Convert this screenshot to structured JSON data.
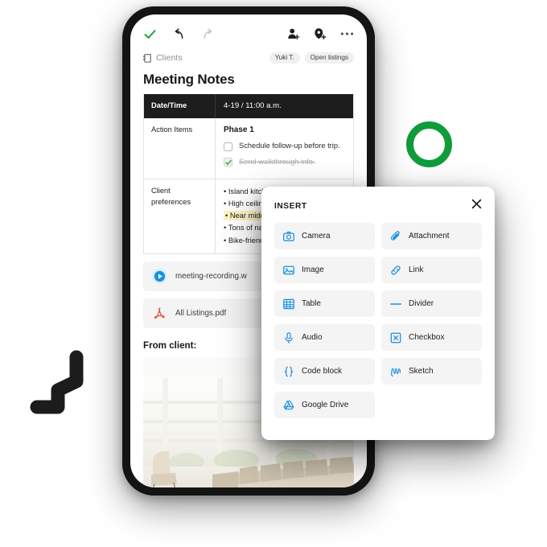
{
  "app": {
    "toolbar": {
      "confirm_label": "check-icon",
      "undo_label": "undo-icon",
      "redo_label": "redo-icon",
      "add_person_label": "add-person-icon",
      "add_tag_label": "add-tag-icon",
      "more_label": "more-options-icon"
    },
    "breadcrumb": {
      "icon": "notebook-icon",
      "label": "Clients"
    },
    "chips": [
      {
        "label": "Yuki T."
      },
      {
        "label": "Open listings"
      }
    ],
    "title": "Meeting Notes"
  },
  "table": {
    "header": {
      "key": "Date/Time",
      "value": "4-19 / 11:00 a.m."
    },
    "rows": [
      {
        "key": "Action Items",
        "phase": "Phase 1",
        "checklist": [
          {
            "label": "Schedule follow-up before trip.",
            "checked": false
          },
          {
            "label": "Send walkthrough info.",
            "checked": true
          }
        ]
      },
      {
        "key": "Client preferences",
        "bullets": [
          {
            "text": "Island kitchen",
            "highlighted": false
          },
          {
            "text": "High ceilin",
            "highlighted": false
          },
          {
            "text": "Near midd",
            "highlighted": true
          },
          {
            "text": "Tons of na",
            "highlighted": false
          },
          {
            "text": "Bike-friend",
            "highlighted": false
          }
        ]
      }
    ]
  },
  "attachments": [
    {
      "name": "meeting-recording.w",
      "icon": "play-circle-icon"
    },
    {
      "name": "All Listings.pdf",
      "icon": "pdf-icon"
    }
  ],
  "from_client": {
    "heading": "From client:",
    "image": "living-room-photo"
  },
  "insert_panel": {
    "title": "INSERT",
    "close_label": "close-icon",
    "options": [
      {
        "label": "Camera",
        "icon": "camera-icon"
      },
      {
        "label": "Attachment",
        "icon": "paperclip-icon"
      },
      {
        "label": "Image",
        "icon": "image-icon"
      },
      {
        "label": "Link",
        "icon": "link-icon"
      },
      {
        "label": "Table",
        "icon": "table-icon"
      },
      {
        "label": "Divider",
        "icon": "divider-icon"
      },
      {
        "label": "Audio",
        "icon": "microphone-icon"
      },
      {
        "label": "Checkbox",
        "icon": "checkbox-x-icon"
      },
      {
        "label": "Code block",
        "icon": "code-braces-icon"
      },
      {
        "label": "Sketch",
        "icon": "sketch-icon"
      },
      {
        "label": "Google Drive",
        "icon": "google-drive-icon"
      }
    ]
  },
  "decorations": {
    "ring": {
      "name": "green-ring-decoration",
      "color": "#109c3b"
    },
    "zigzag": {
      "name": "zigzag-decoration",
      "color": "#1c1c1c"
    }
  },
  "colors": {
    "accent_blue": "#1a8fe0",
    "green": "#159c3f",
    "dark": "#141414"
  }
}
